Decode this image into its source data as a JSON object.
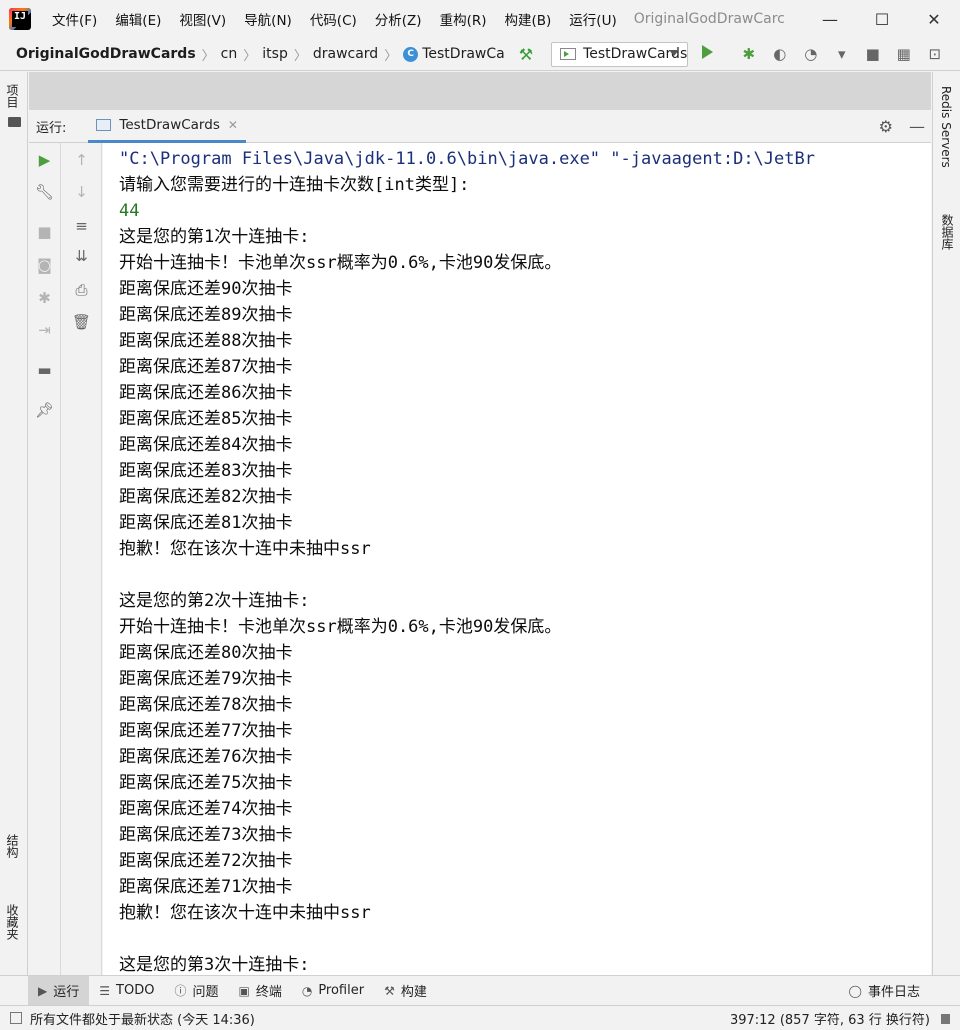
{
  "menubar": {
    "logo_text": "IJ",
    "items": [
      "文件(F)",
      "编辑(E)",
      "视图(V)",
      "导航(N)",
      "代码(C)",
      "分析(Z)",
      "重构(R)",
      "构建(B)",
      "运行(U)"
    ],
    "title": "OriginalGodDrawCarc"
  },
  "navbar": {
    "crumbs": [
      "OriginalGodDrawCards",
      "cn",
      "itsp",
      "drawcard"
    ],
    "file_badge": "C",
    "file": "TestDrawCa",
    "run_config": "TestDrawCards"
  },
  "left_bar": {
    "project": "项目",
    "structure": "结构",
    "favorites": "收藏夹"
  },
  "right_bar": {
    "redis": "Redis Servers",
    "database": "数据库"
  },
  "run_panel": {
    "label": "运行:",
    "tab": "TestDrawCards"
  },
  "console": {
    "command": "\"C:\\Program Files\\Java\\jdk-11.0.6\\bin\\java.exe\" \"-javaagent:D:\\JetBr",
    "lines": [
      "请输入您需要进行的十连抽卡次数[int类型]:",
      "44",
      "这是您的第1次十连抽卡:",
      "开始十连抽卡！卡池单次ssr概率为0.6%,卡池90发保底。",
      "距离保底还差90次抽卡",
      "距离保底还差89次抽卡",
      "距离保底还差88次抽卡",
      "距离保底还差87次抽卡",
      "距离保底还差86次抽卡",
      "距离保底还差85次抽卡",
      "距离保底还差84次抽卡",
      "距离保底还差83次抽卡",
      "距离保底还差82次抽卡",
      "距离保底还差81次抽卡",
      "抱歉！您在该次十连中未抽中ssr",
      "",
      "这是您的第2次十连抽卡:",
      "开始十连抽卡！卡池单次ssr概率为0.6%,卡池90发保底。",
      "距离保底还差80次抽卡",
      "距离保底还差79次抽卡",
      "距离保底还差78次抽卡",
      "距离保底还差77次抽卡",
      "距离保底还差76次抽卡",
      "距离保底还差75次抽卡",
      "距离保底还差74次抽卡",
      "距离保底还差73次抽卡",
      "距离保底还差72次抽卡",
      "距离保底还差71次抽卡",
      "抱歉！您在该次十连中未抽中ssr",
      "",
      "这是您的第3次十连抽卡:"
    ]
  },
  "tool_windows": [
    "运行",
    "TODO",
    "问题",
    "终端",
    "Profiler",
    "构建"
  ],
  "event_log": "事件日志",
  "status": {
    "message": "所有文件都处于最新状态 (今天 14:36)",
    "position": "397:12 (857 字符, 63 行 换行符)"
  }
}
